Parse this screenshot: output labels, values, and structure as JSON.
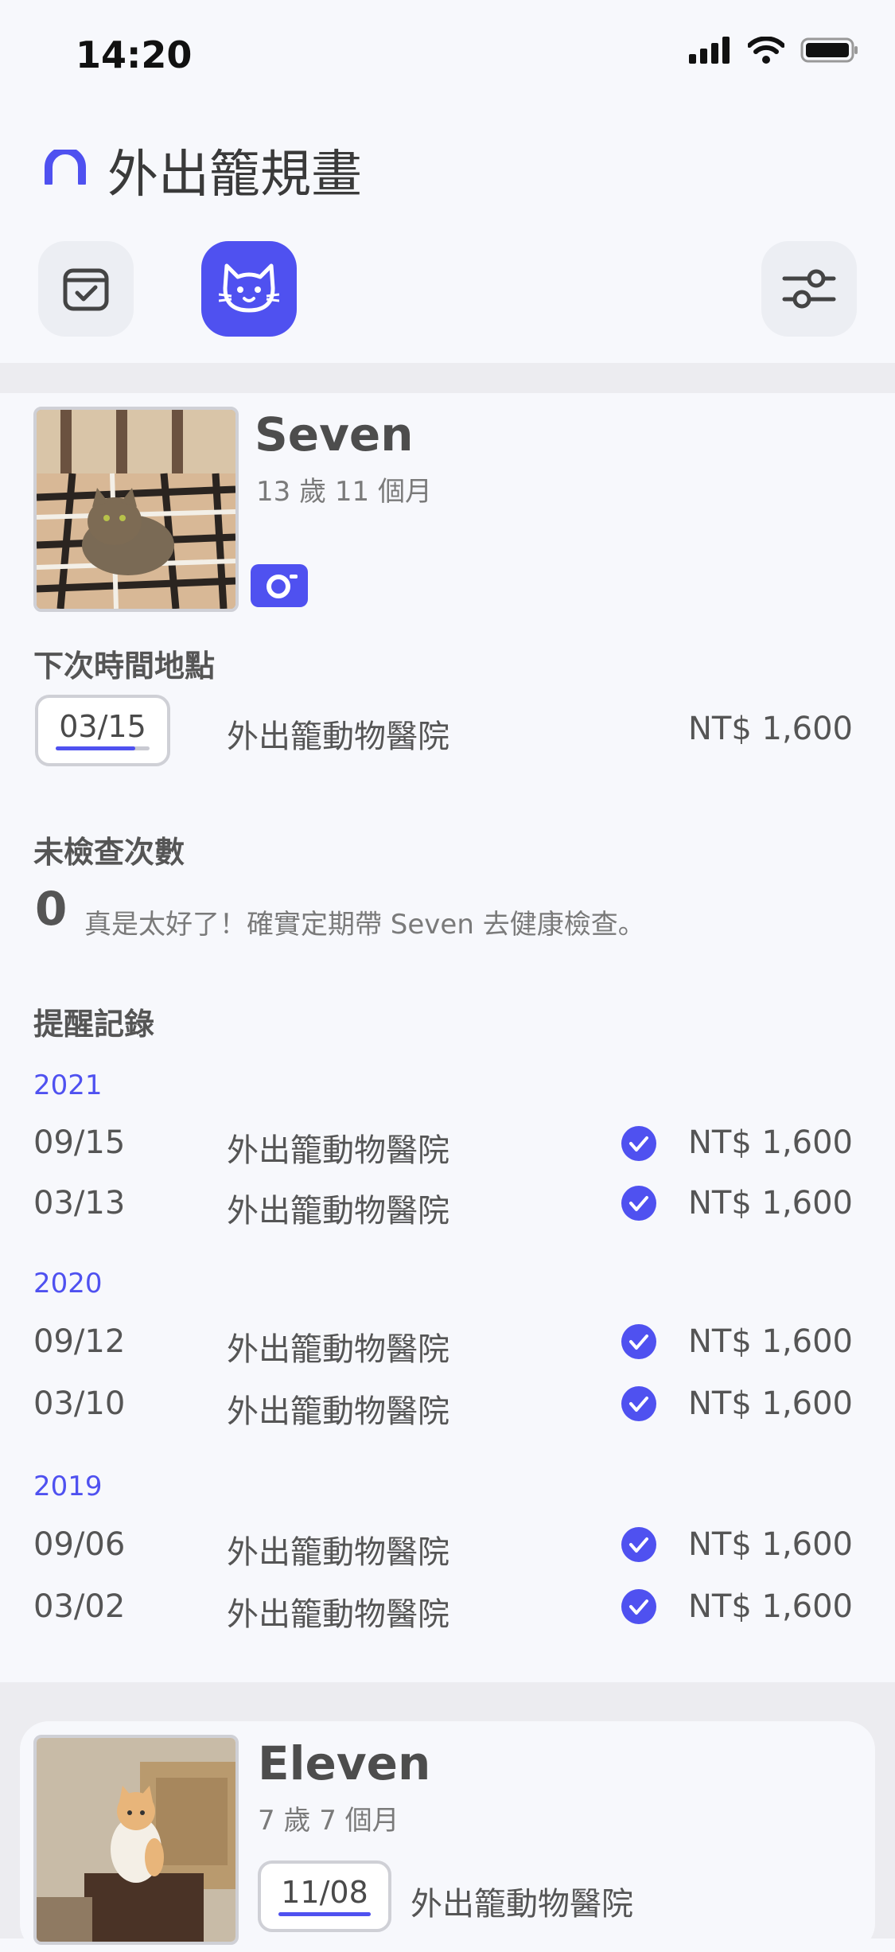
{
  "status_bar": {
    "time": "14:20"
  },
  "app": {
    "title": "外出籠規畫"
  },
  "toolbar": {
    "calendar_icon": "calendar-check-icon",
    "cat_icon": "cat-icon",
    "settings_icon": "sliders-icon"
  },
  "colors": {
    "accent": "#4f51f0",
    "text": "#555555",
    "muted": "#7a7a7a",
    "band": "#ececf0"
  },
  "pet1": {
    "name": "Seven",
    "age": "13 歲 11 個月",
    "next_title": "下次時間地點",
    "next_date": "03/15",
    "next_hospital": "外出籠動物醫院",
    "next_price": "NT$ 1,600",
    "unchecked_title": "未檢查次數",
    "unchecked_count": "0",
    "unchecked_msg": "真是太好了！確實定期帶 Seven 去健康檢查。",
    "records_title": "提醒記錄",
    "years": [
      {
        "year": "2021",
        "records": [
          {
            "date": "09/15",
            "hospital": "外出籠動物醫院",
            "price": "NT$ 1,600"
          },
          {
            "date": "03/13",
            "hospital": "外出籠動物醫院",
            "price": "NT$ 1,600"
          }
        ]
      },
      {
        "year": "2020",
        "records": [
          {
            "date": "09/12",
            "hospital": "外出籠動物醫院",
            "price": "NT$ 1,600"
          },
          {
            "date": "03/10",
            "hospital": "外出籠動物醫院",
            "price": "NT$ 1,600"
          }
        ]
      },
      {
        "year": "2019",
        "records": [
          {
            "date": "09/06",
            "hospital": "外出籠動物醫院",
            "price": "NT$ 1,600"
          },
          {
            "date": "03/02",
            "hospital": "外出籠動物醫院",
            "price": "NT$ 1,600"
          }
        ]
      }
    ]
  },
  "pet2": {
    "name": "Eleven",
    "age": "7 歲 7 個月",
    "next_date": "11/08",
    "next_hospital": "外出籠動物醫院"
  }
}
